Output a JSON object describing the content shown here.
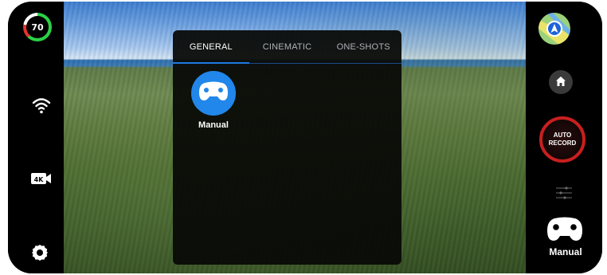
{
  "status": {
    "battery_level": "70",
    "video_resolution_icon": "4k-camera-icon",
    "wifi_icon": "wifi-icon",
    "settings_icon": "gear-icon"
  },
  "menu": {
    "tabs": [
      {
        "label": "GENERAL",
        "active": true
      },
      {
        "label": "CINEMATIC",
        "active": false
      },
      {
        "label": "ONE-SHOTS",
        "active": false
      }
    ],
    "modes": [
      {
        "label": "Manual",
        "icon": "gamepad-icon"
      }
    ]
  },
  "right_controls": {
    "map_icon": "map-navigation-icon",
    "home_icon": "home-icon",
    "record_label_line1": "AUTO",
    "record_label_line2": "RECORD",
    "sliders_icon": "sliders-icon",
    "current_mode_label": "Manual"
  },
  "colors": {
    "accent_blue": "#2187ea",
    "record_red": "#c81f1f",
    "battery_green": "#2bd145"
  }
}
